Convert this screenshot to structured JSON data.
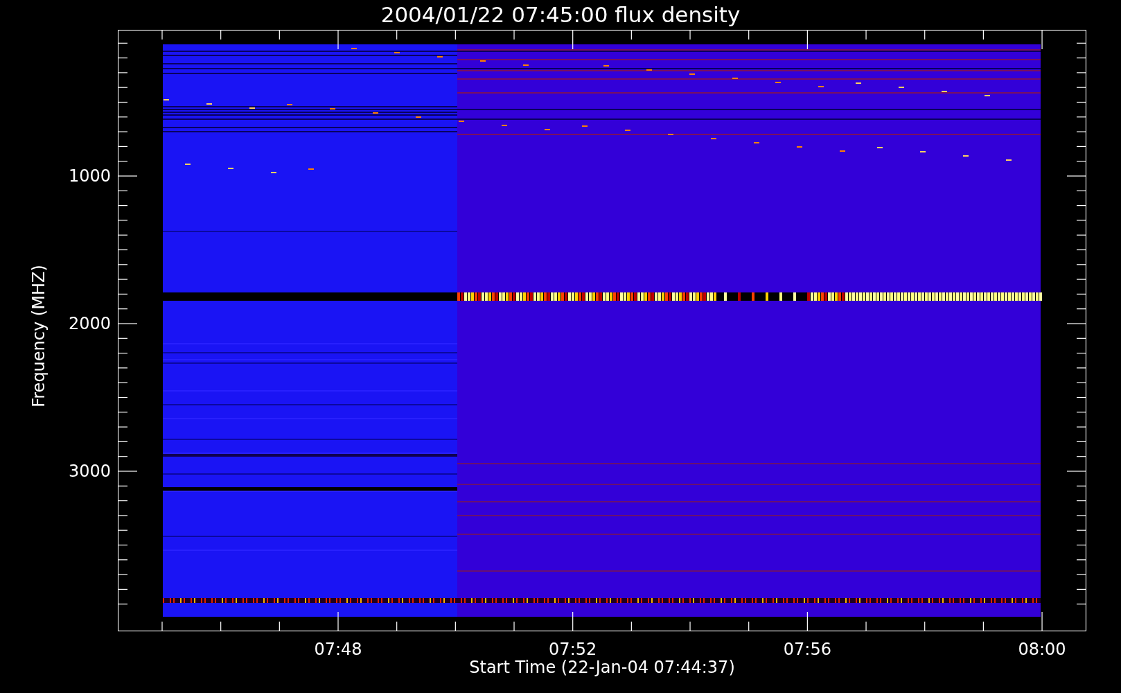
{
  "title": "2004/01/22 07:45:00 flux density",
  "y_axis": {
    "label": "Frequency (MHZ)",
    "ticks": [
      "1000",
      "2000",
      "3000"
    ]
  },
  "x_axis": {
    "label": "Start Time (22-Jan-04 07:44:37)",
    "ticks": [
      "07:48",
      "07:52",
      "07:56",
      "08:00"
    ]
  }
}
